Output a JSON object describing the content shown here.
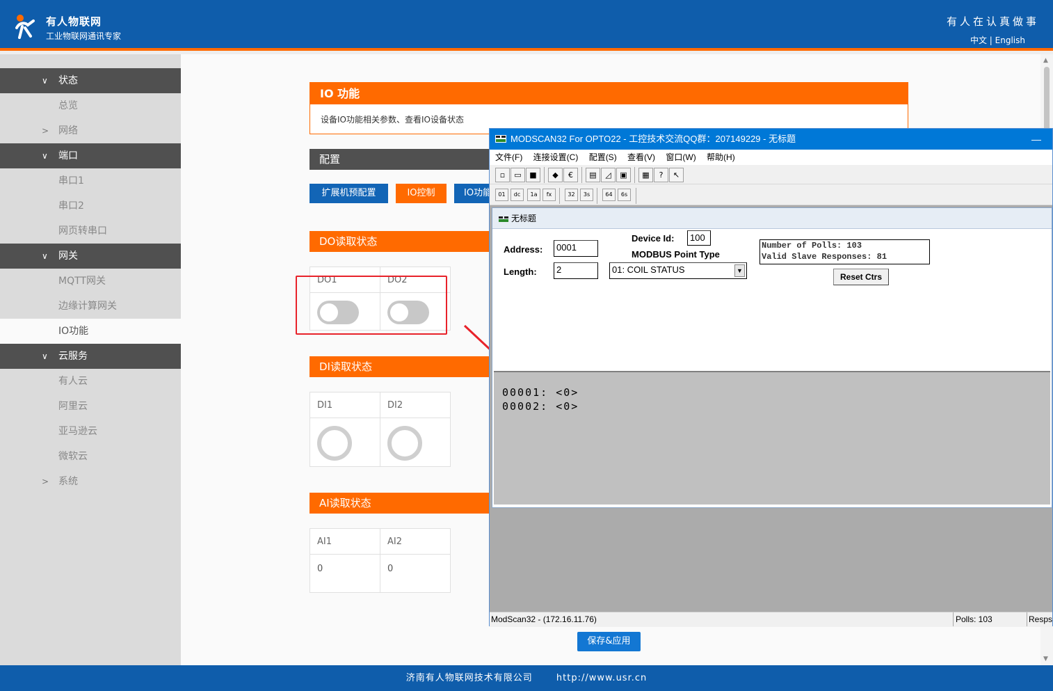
{
  "header": {
    "brand": "有人物联网",
    "tagline": "工业物联网通讯专家",
    "slogan": "有人在认真做事",
    "lang_zh": "中文",
    "lang_sep": "|",
    "lang_en": "English"
  },
  "sidebar": {
    "items": [
      {
        "label": "状态",
        "type": "group",
        "chev": "∨"
      },
      {
        "label": "总览",
        "type": "sub"
      },
      {
        "label": "网络",
        "type": "collapsed",
        "chev": ">"
      },
      {
        "label": "端口",
        "type": "group",
        "chev": "∨"
      },
      {
        "label": "串口1",
        "type": "sub"
      },
      {
        "label": "串口2",
        "type": "sub"
      },
      {
        "label": "网页转串口",
        "type": "sub"
      },
      {
        "label": "网关",
        "type": "group",
        "chev": "∨"
      },
      {
        "label": "MQTT网关",
        "type": "sub"
      },
      {
        "label": "边缘计算网关",
        "type": "sub"
      },
      {
        "label": "IO功能",
        "type": "active"
      },
      {
        "label": "云服务",
        "type": "group",
        "chev": "∨"
      },
      {
        "label": "有人云",
        "type": "sub"
      },
      {
        "label": "阿里云",
        "type": "sub"
      },
      {
        "label": "亚马逊云",
        "type": "sub"
      },
      {
        "label": "微软云",
        "type": "sub"
      },
      {
        "label": "系统",
        "type": "collapsed",
        "chev": ">"
      }
    ]
  },
  "main": {
    "section_title": "IO 功能",
    "section_desc": "设备IO功能相关参数、查看IO设备状态",
    "config_title": "配置",
    "tabs": [
      {
        "label": "扩展机预配置",
        "color": "#1265b6"
      },
      {
        "label": "IO控制",
        "color": "#ff6a00"
      },
      {
        "label": "IO功能",
        "color": "#1265b6"
      }
    ],
    "do_title": "DO读取状态",
    "do_headers": [
      "DO1",
      "DO2"
    ],
    "di_title": "DI读取状态",
    "di_headers": [
      "DI1",
      "DI2"
    ],
    "ai_title": "AI读取状态",
    "ai_headers": [
      "AI1",
      "AI2"
    ],
    "ai_values": [
      "0",
      "0"
    ],
    "save_label": "保存&应用"
  },
  "modscan": {
    "title": "MODSCAN32 For OPTO22 - 工控技术交流QQ群：207149229 - 无标题",
    "minimize": "—",
    "menu": [
      "文件(F)",
      "连接设置(C)",
      "配置(S)",
      "查看(V)",
      "窗口(W)",
      "帮助(H)"
    ],
    "child_title": "无标题",
    "address_label": "Address:",
    "address_value": "0001",
    "length_label": "Length:",
    "length_value": "2",
    "device_id_label": "Device Id:",
    "device_id_value": "100",
    "point_type_label": "MODBUS Point Type",
    "point_type_value": "01: COIL STATUS",
    "polls_line": "Number of Polls: 103",
    "valid_line": "Valid Slave Responses: 81",
    "reset_label": "Reset Ctrs",
    "data_lines": [
      "00001:  <0>",
      "00002:  <0>"
    ],
    "status_main": "ModScan32 - (172.16.11.76)",
    "status_polls": "Polls: 103",
    "status_resp": "Resps"
  },
  "footer": {
    "company": "济南有人物联网技术有限公司",
    "url": "http://www.usr.cn"
  },
  "colors": {
    "brand_blue": "#0f5dab",
    "accent_orange": "#ff6a00",
    "highlight_red": "#e8222a"
  }
}
